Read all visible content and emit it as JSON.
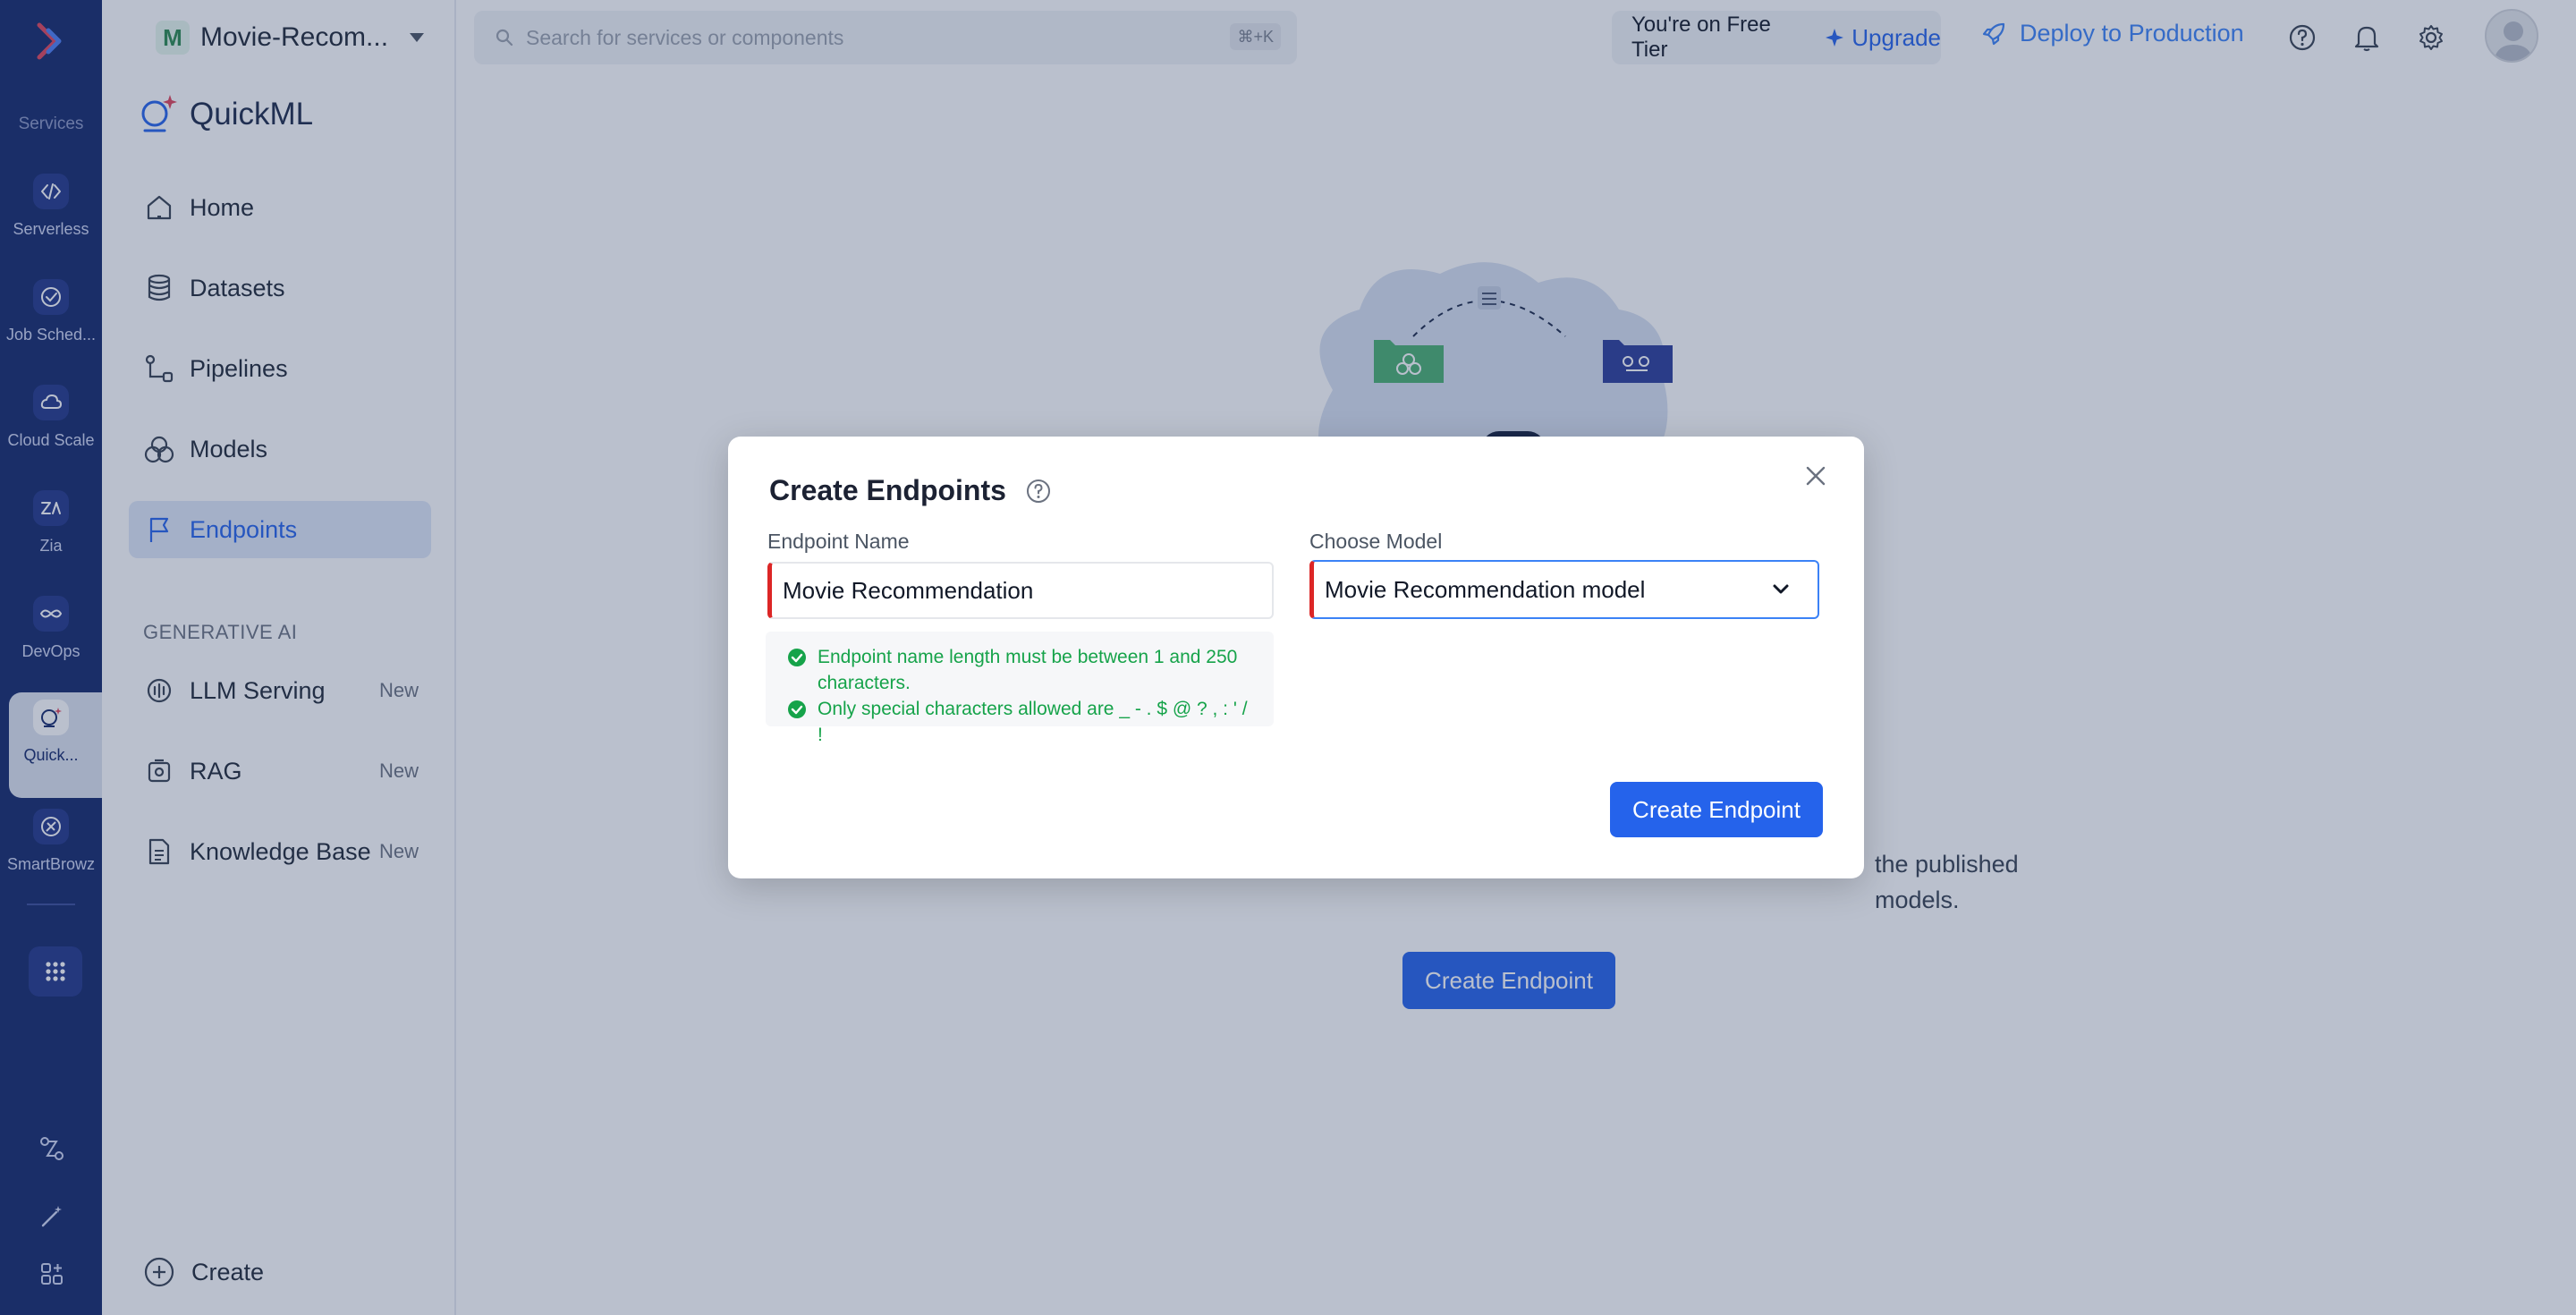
{
  "rail": {
    "services_label": "Services",
    "items": [
      {
        "label": "Serverless",
        "icon": "serverless-icon"
      },
      {
        "label": "Job Sched...",
        "icon": "job-scheduler-icon"
      },
      {
        "label": "Cloud Scale",
        "icon": "cloud-scale-icon"
      },
      {
        "label": "Zia",
        "icon": "zia-icon"
      },
      {
        "label": "DevOps",
        "icon": "devops-icon"
      },
      {
        "label": "Quick...",
        "icon": "quickml-icon"
      },
      {
        "label": "SmartBrowz",
        "icon": "smartbrowz-icon"
      }
    ]
  },
  "project": {
    "initial": "M",
    "name": "Movie-Recom..."
  },
  "brand": {
    "name": "QuickML"
  },
  "nav": {
    "items": [
      {
        "label": "Home"
      },
      {
        "label": "Datasets"
      },
      {
        "label": "Pipelines"
      },
      {
        "label": "Models"
      },
      {
        "label": "Endpoints"
      }
    ],
    "section_label": "GENERATIVE AI",
    "gen_items": [
      {
        "label": "LLM Serving",
        "badge": "New"
      },
      {
        "label": "RAG",
        "badge": "New"
      },
      {
        "label": "Knowledge Base",
        "badge": "New"
      }
    ],
    "create_label": "Create"
  },
  "topbar": {
    "search_placeholder": "Search for services or components",
    "search_shortcut": "⌘+K",
    "tier_text": "You're on Free Tier",
    "upgrade_label": "Upgrade",
    "deploy_label": "Deploy to Production"
  },
  "main": {
    "empty_description": "the published models.",
    "create_button": "Create Endpoint"
  },
  "modal": {
    "title": "Create Endpoints",
    "endpoint_name_label": "Endpoint Name",
    "endpoint_name_value": "Movie Recommendation",
    "choose_model_label": "Choose Model",
    "choose_model_value": "Movie Recommendation model",
    "hints": [
      "Endpoint name length must be between 1 and 250 characters.",
      "Only special characters allowed are _ - . $ @ ? , : ' / !"
    ],
    "submit_label": "Create Endpoint"
  },
  "colors": {
    "rail_bg": "#14286b",
    "accent": "#2563eb",
    "success": "#16a34a",
    "required": "#dc2626"
  }
}
